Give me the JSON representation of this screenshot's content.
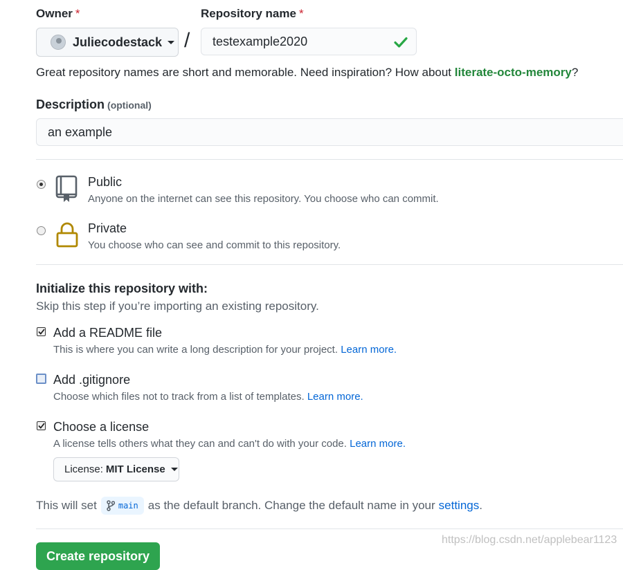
{
  "owner": {
    "label": "Owner",
    "required_mark": "*",
    "selected": "Juliecodestack",
    "icon": "avatar-icon"
  },
  "separator": "/",
  "repo_name": {
    "label": "Repository name",
    "required_mark": "*",
    "value": "testexample2020",
    "status_icon": "check-icon",
    "status_color": "#28a745"
  },
  "hint": {
    "prefix": "Great repository names are short and memorable. Need inspiration? How about ",
    "suggestion": "literate-octo-memory",
    "suffix": "?"
  },
  "description": {
    "label": "Description",
    "optional_tag": "(optional)",
    "value": "an example"
  },
  "visibility": {
    "public": {
      "title": "Public",
      "subtitle": "Anyone on the internet can see this repository. You choose who can commit.",
      "icon": "repo-icon",
      "selected": true
    },
    "private": {
      "title": "Private",
      "subtitle": "You choose who can see and commit to this repository.",
      "icon": "lock-icon",
      "icon_color": "#b08800",
      "selected": false
    }
  },
  "init": {
    "title": "Initialize this repository with:",
    "subtitle": "Skip this step if you’re importing an existing repository.",
    "readme": {
      "label": "Add a README file",
      "desc": "This is where you can write a long description for your project.",
      "link": "Learn more.",
      "checked": true
    },
    "gitignore": {
      "label": "Add .gitignore",
      "desc": "Choose which files not to track from a list of templates.",
      "link": "Learn more.",
      "checked": false
    },
    "license": {
      "label": "Choose a license",
      "desc": "A license tells others what they can and can't do with your code.",
      "link": "Learn more.",
      "checked": true,
      "select_prefix": "License:",
      "select_value": "MIT License"
    }
  },
  "branch": {
    "prefix": "This will set",
    "name": "main",
    "middle": "as the default branch. Change the default name in your",
    "link": "settings",
    "suffix": "."
  },
  "submit": {
    "label": "Create repository"
  },
  "watermark": "https://blog.csdn.net/applebear1123",
  "colors": {
    "accent_green": "#2ea44f",
    "link_blue": "#0366d6",
    "suggestion_green": "#22863a",
    "required_red": "#cb2431"
  }
}
